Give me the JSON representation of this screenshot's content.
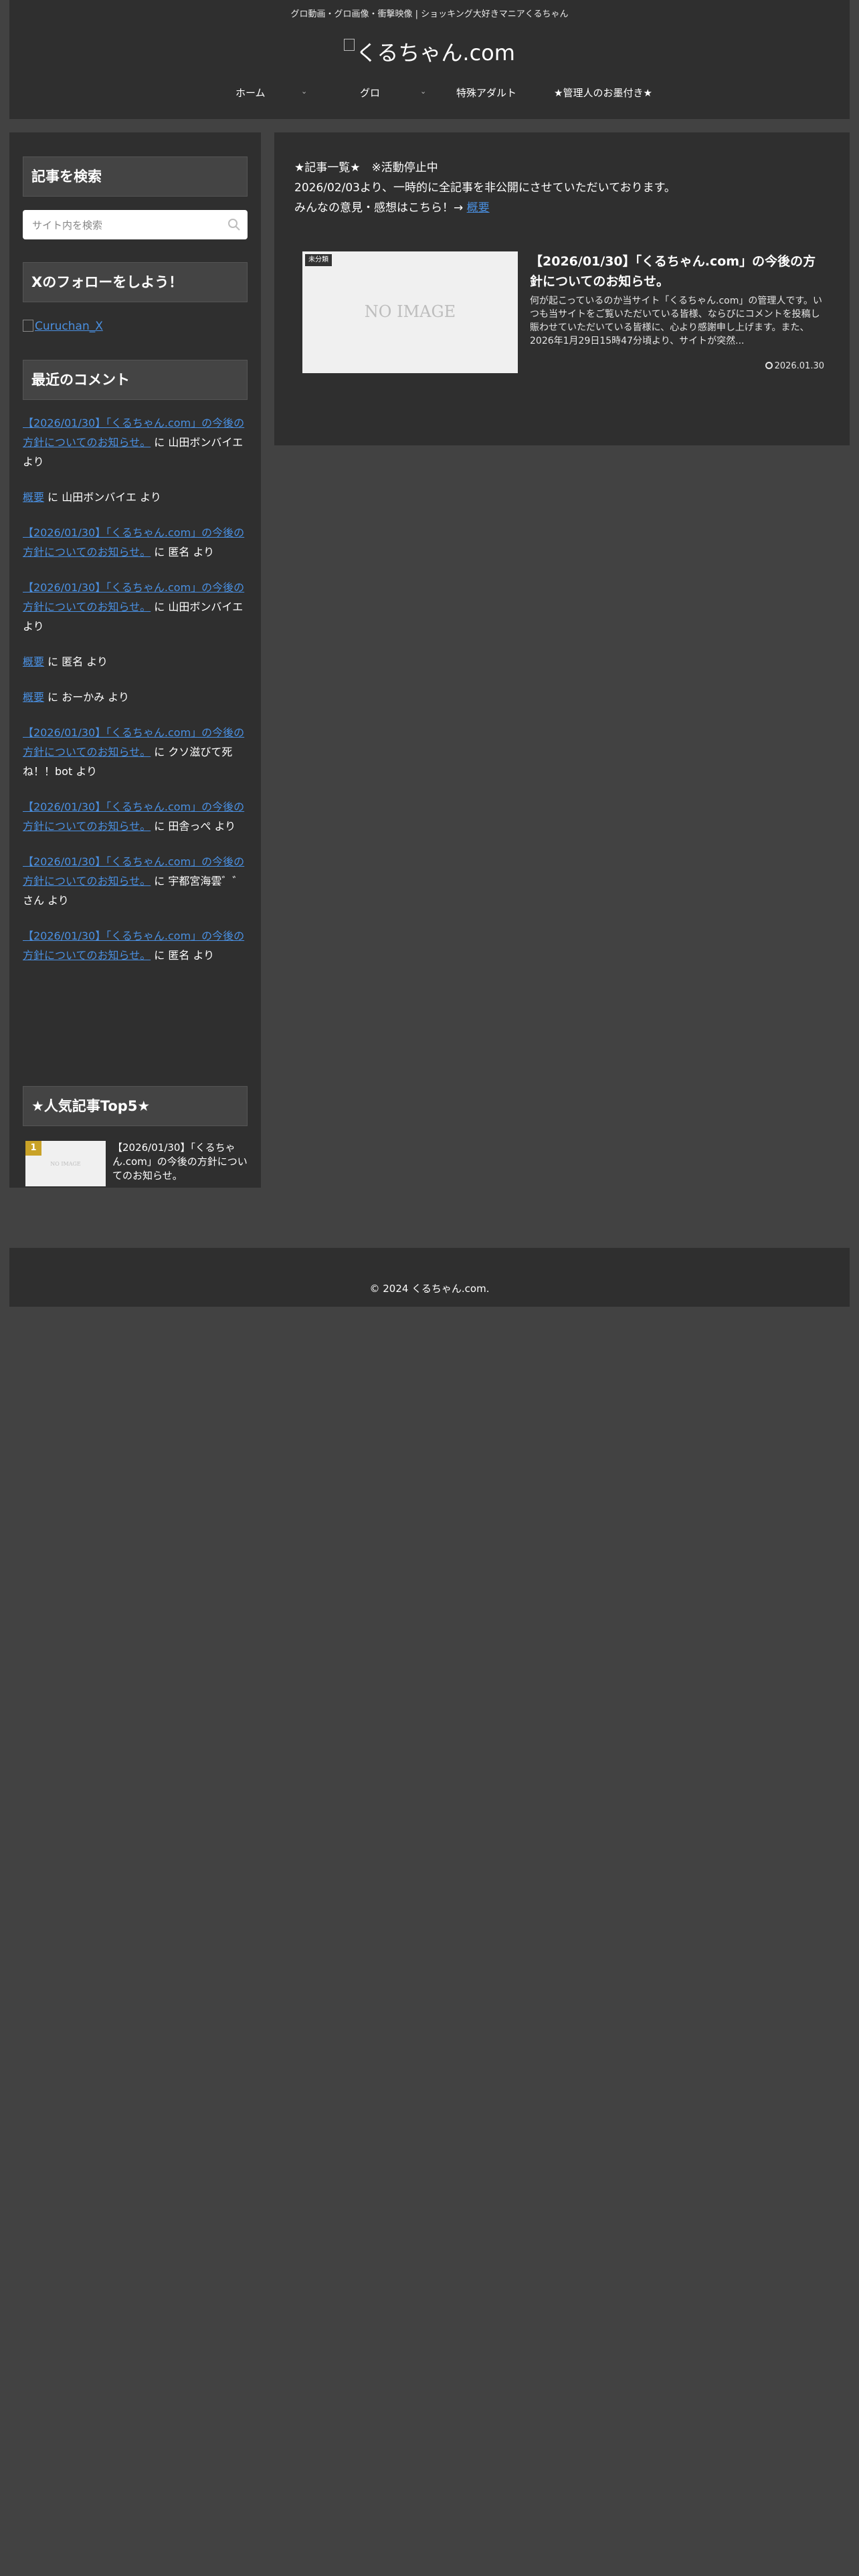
{
  "header": {
    "tagline": "グロ動画・グロ画像・衝撃映像 | ショッキング大好きマニアくるちゃん",
    "site_title": "くるちゃん.com"
  },
  "nav": {
    "items": [
      {
        "label": "ホーム",
        "has_dropdown": true
      },
      {
        "label": "グロ",
        "has_dropdown": true
      },
      {
        "label": "特殊アダルト",
        "has_dropdown": false
      },
      {
        "label": "★管理人のお墨付き★",
        "has_dropdown": false
      }
    ],
    "caret": "⌄"
  },
  "sidebar": {
    "search_title": "記事を検索",
    "search_placeholder": "サイト内を検索",
    "follow_title": "Xのフォローをしよう！",
    "follow_link_text": "Curuchan_X",
    "recent_comments_title": "最近のコメント",
    "comments": [
      {
        "link": "【2026/01/30】「くるちゃん.com」の今後の方針についてのお知らせ。",
        "mid": " に ",
        "author": "山田ボンバイエ",
        "suffix": " より"
      },
      {
        "link": "概要",
        "mid": " に ",
        "author": "山田ボンバイエ",
        "suffix": " より"
      },
      {
        "link": "【2026/01/30】「くるちゃん.com」の今後の方針についてのお知らせ。",
        "mid": " に ",
        "author": "匿名",
        "suffix": " より"
      },
      {
        "link": "【2026/01/30】「くるちゃん.com」の今後の方針についてのお知らせ。",
        "mid": " に ",
        "author": "山田ボンバイエ",
        "suffix": " より"
      },
      {
        "link": "概要",
        "mid": " に ",
        "author": "匿名",
        "suffix": " より"
      },
      {
        "link": "概要",
        "mid": " に ",
        "author": "おーかみ",
        "suffix": " より"
      },
      {
        "link": "【2026/01/30】「くるちゃん.com」の今後の方針についてのお知らせ。",
        "mid": " に ",
        "author": "クソ滋びて死ね！！bot",
        "suffix": " より"
      },
      {
        "link": "【2026/01/30】「くるちゃん.com」の今後の方針についてのお知らせ。",
        "mid": " に ",
        "author": "田舎っぺ",
        "suffix": " より"
      },
      {
        "link": "【2026/01/30】「くるちゃん.com」の今後の方針についてのお知らせ。",
        "mid": " に ",
        "author": "宇都宮海雲゛゛さん",
        "suffix": " より"
      },
      {
        "link": "【2026/01/30】「くるちゃん.com」の今後の方針についてのお知らせ。",
        "mid": " に ",
        "author": "匿名",
        "suffix": " より"
      }
    ],
    "popular_title": "★人気記事Top5★",
    "popular": [
      {
        "rank": "1",
        "thumb_text": "NO IMAGE",
        "title": "【2026/01/30】「くるちゃん.com」の今後の方針についてのお知らせ。"
      }
    ]
  },
  "main": {
    "notice": {
      "line1": "★記事一覧★　※活動停止中",
      "line2": "2026/02/03より、一時的に全記事を非公開にさせていただいております。",
      "line3_prefix": "みんなの意見・感想はこちら！→ ",
      "line3_link": "概要"
    },
    "articles": [
      {
        "badge": "未分類",
        "thumb_text": "NO IMAGE",
        "title": "【2026/01/30】「くるちゃん.com」の今後の方針についてのお知らせ。",
        "snippet": "何が起こっているのか当サイト「くるちゃん.com」の管理人です。いつも当サイトをご覧いただいている皆様、ならびにコメントを投稿し賑わせていただいている皆様に、心より感謝申し上げます。また、2026年1月29日15時47分頃より、サイトが突然...",
        "date": "2026.01.30"
      }
    ]
  },
  "footer": {
    "copyright": "© 2024 くるちゃん.com."
  }
}
